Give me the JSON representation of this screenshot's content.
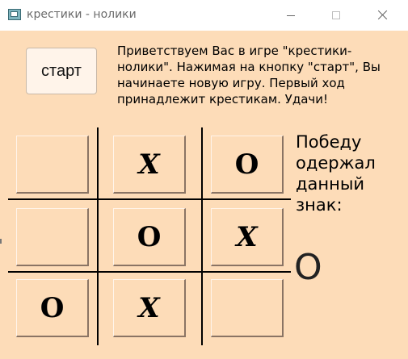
{
  "window": {
    "title": "крестики - нолики",
    "controls": [
      "minimize-icon",
      "maximize-icon",
      "close-icon"
    ]
  },
  "start_button": {
    "label": "старт"
  },
  "greeting": "Приветствуем Вас в игре \"крестики-нолики\". Нажимая на кнопку \"старт\", Вы начинаете новую игру. Первый ход принадлежит крестикам. Удачи!",
  "board": {
    "cells": [
      "",
      "X",
      "O",
      "",
      "O",
      "X",
      "O",
      "X",
      ""
    ]
  },
  "winner": {
    "label": "Победу одержал данный знак:",
    "sign": "O"
  },
  "colors": {
    "background": "#fddcb8",
    "button": "#fff4ea",
    "lines": "#000000"
  }
}
